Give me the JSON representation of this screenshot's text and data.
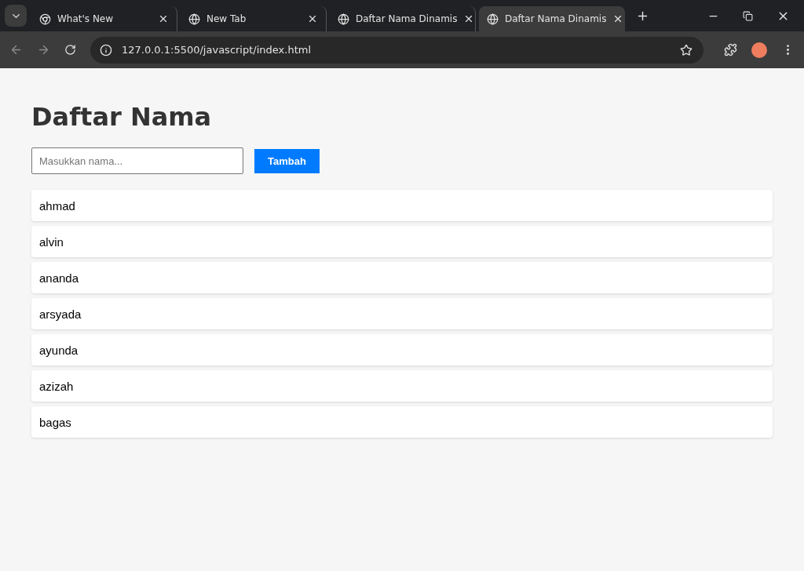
{
  "browser": {
    "tabs": [
      {
        "title": "What's New",
        "kind": "chrome",
        "selected": false
      },
      {
        "title": "New Tab",
        "kind": "globe",
        "selected": false
      },
      {
        "title": "Daftar Nama Dinamis",
        "kind": "globe",
        "selected": false
      },
      {
        "title": "Daftar Nama Dinamis",
        "kind": "globe",
        "selected": true
      }
    ],
    "address": "127.0.0.1:5500/javascript/index.html"
  },
  "page": {
    "heading": "Daftar Nama",
    "input": {
      "placeholder": "Masukkan nama..."
    },
    "button": "Tambah",
    "names": [
      "ahmad",
      "alvin",
      "ananda",
      "arsyada",
      "ayunda",
      "azizah",
      "bagas"
    ]
  }
}
